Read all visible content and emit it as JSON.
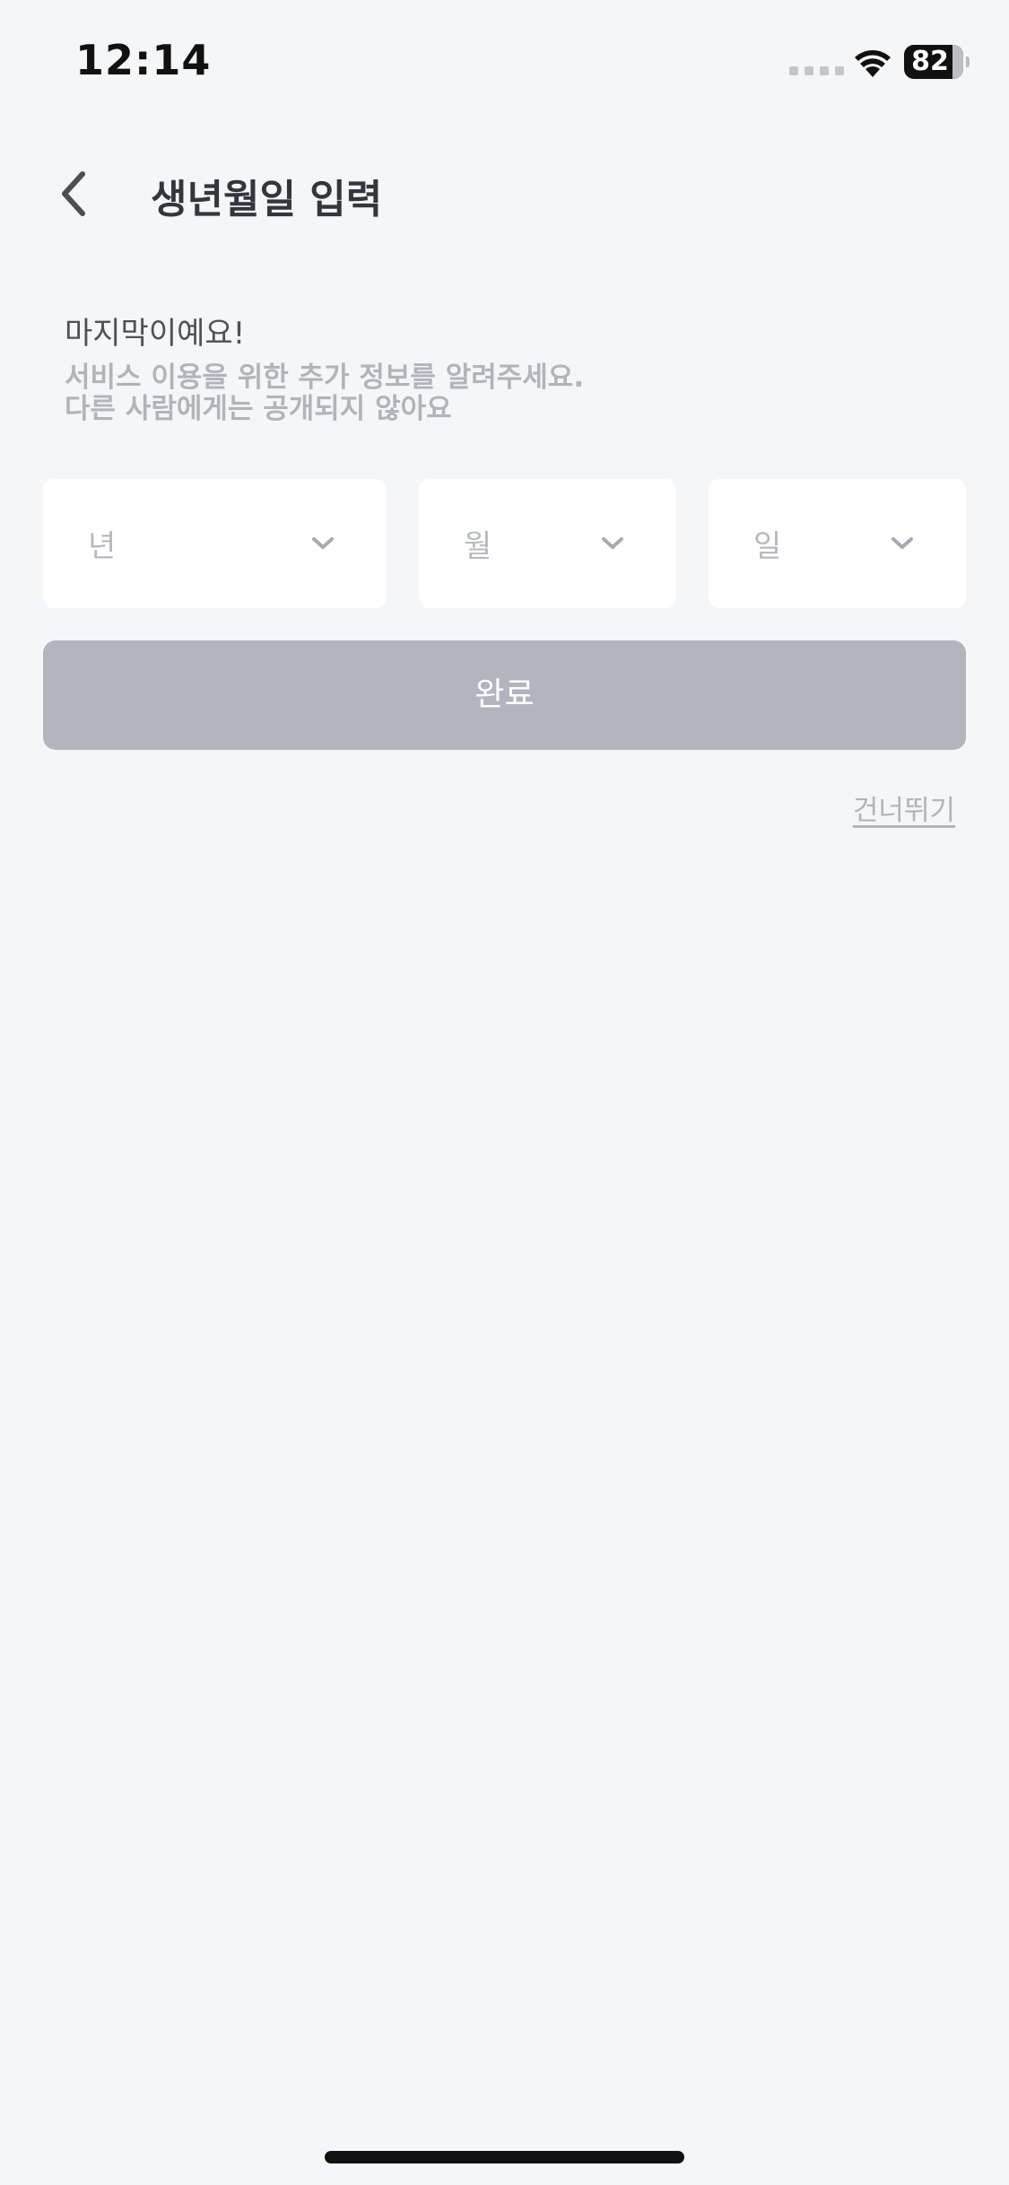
{
  "status_bar": {
    "time": "12:14",
    "battery_level": "82",
    "battery_fraction": 0.82,
    "icons": [
      "signal-icon",
      "wifi-icon",
      "battery-icon"
    ]
  },
  "header": {
    "title": "생년월일 입력",
    "back_icon": "chevron-left-icon"
  },
  "intro": {
    "heading": "마지막이예요!",
    "description_line1": "서비스 이용을 위한 추가 정보를 알려주세요.",
    "description_line2": "다른 사람에게는 공개되지 않아요"
  },
  "selects": {
    "year_placeholder": "년",
    "month_placeholder": "월",
    "day_placeholder": "일",
    "icon": "chevron-down-icon"
  },
  "actions": {
    "complete_label": "완료",
    "skip_label": "건너뛰기"
  },
  "colors": {
    "background": "#f5f6f8",
    "button_disabled": "#b2b5be",
    "muted_text": "#b1b4bb",
    "title_text": "#33373d"
  }
}
